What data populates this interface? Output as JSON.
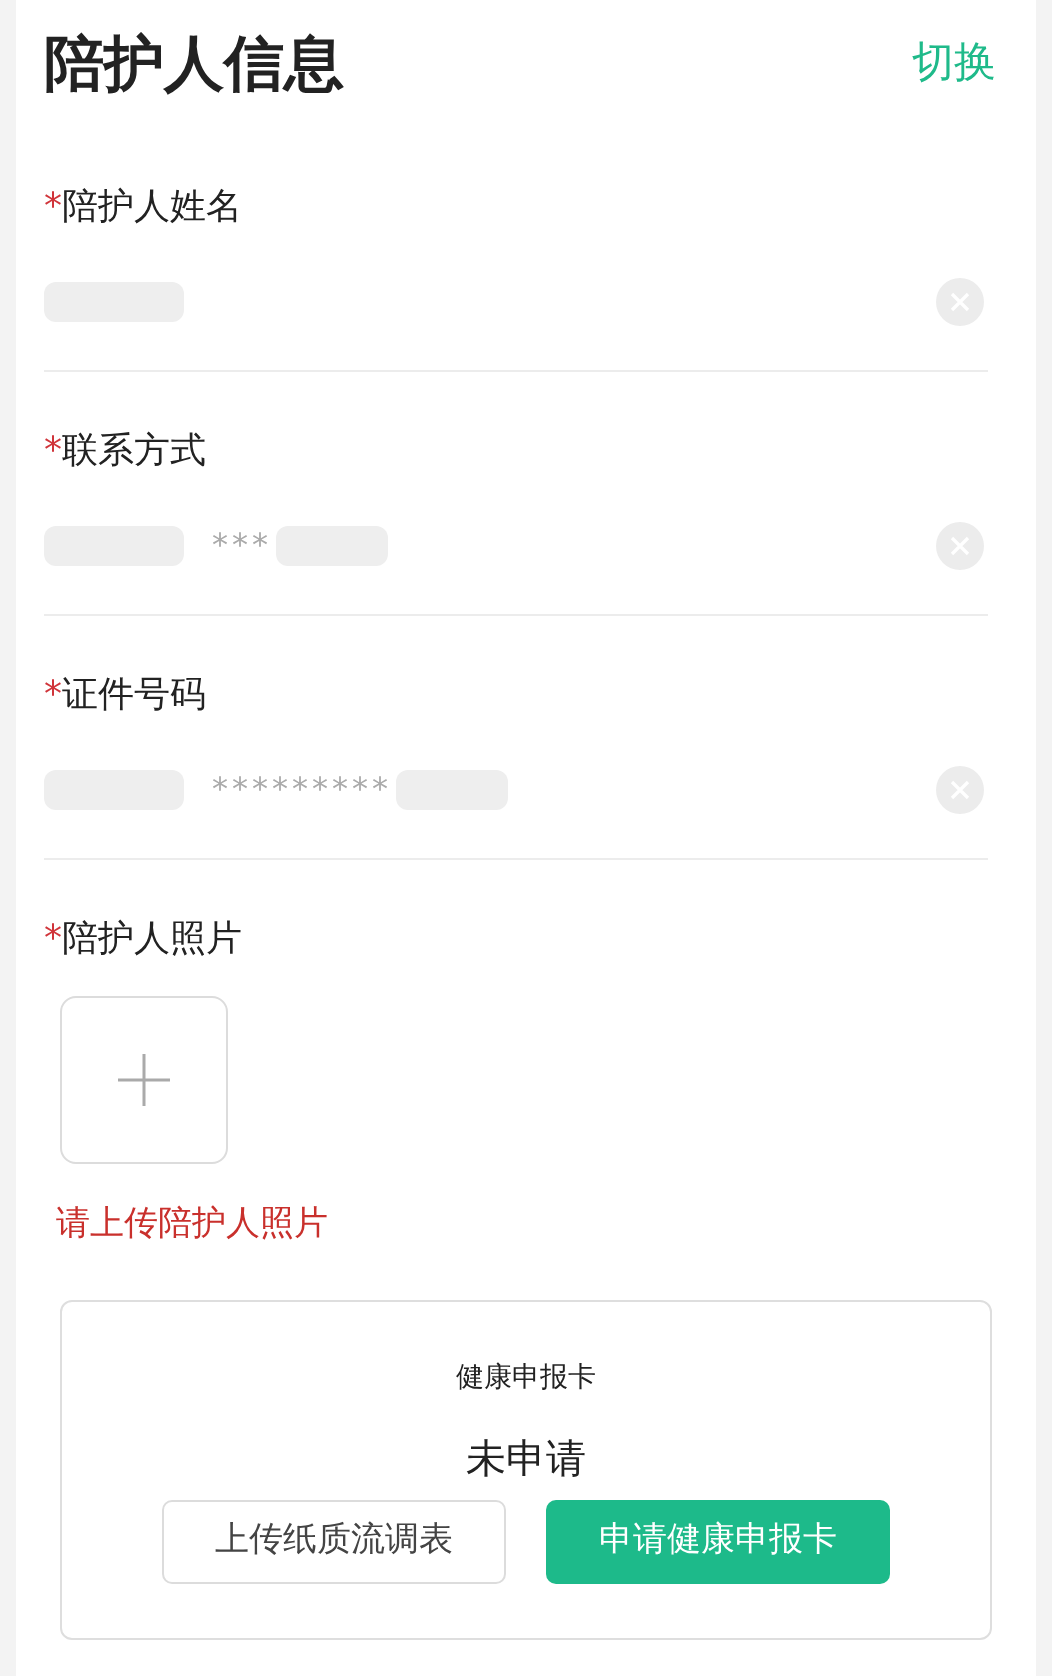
{
  "title": "陪护人信息",
  "switch_link": "切换",
  "fields": [
    {
      "label": "陪护人姓名",
      "required_mark": "*"
    },
    {
      "label": "联系方式",
      "required_mark": "*",
      "value": "***"
    },
    {
      "label": "证件号码",
      "required_mark": "*",
      "value": "*********"
    }
  ],
  "photo": {
    "label": "陪护人照片",
    "required_mark": "*",
    "error": "请上传陪护人照片"
  },
  "health_card": {
    "title": "健康申报卡",
    "status": "未申请",
    "buttons": [
      {
        "label": "上传纸质流调表",
        "kind": "outline"
      },
      {
        "label": "申请健康申报卡",
        "kind": "primary"
      }
    ]
  }
}
